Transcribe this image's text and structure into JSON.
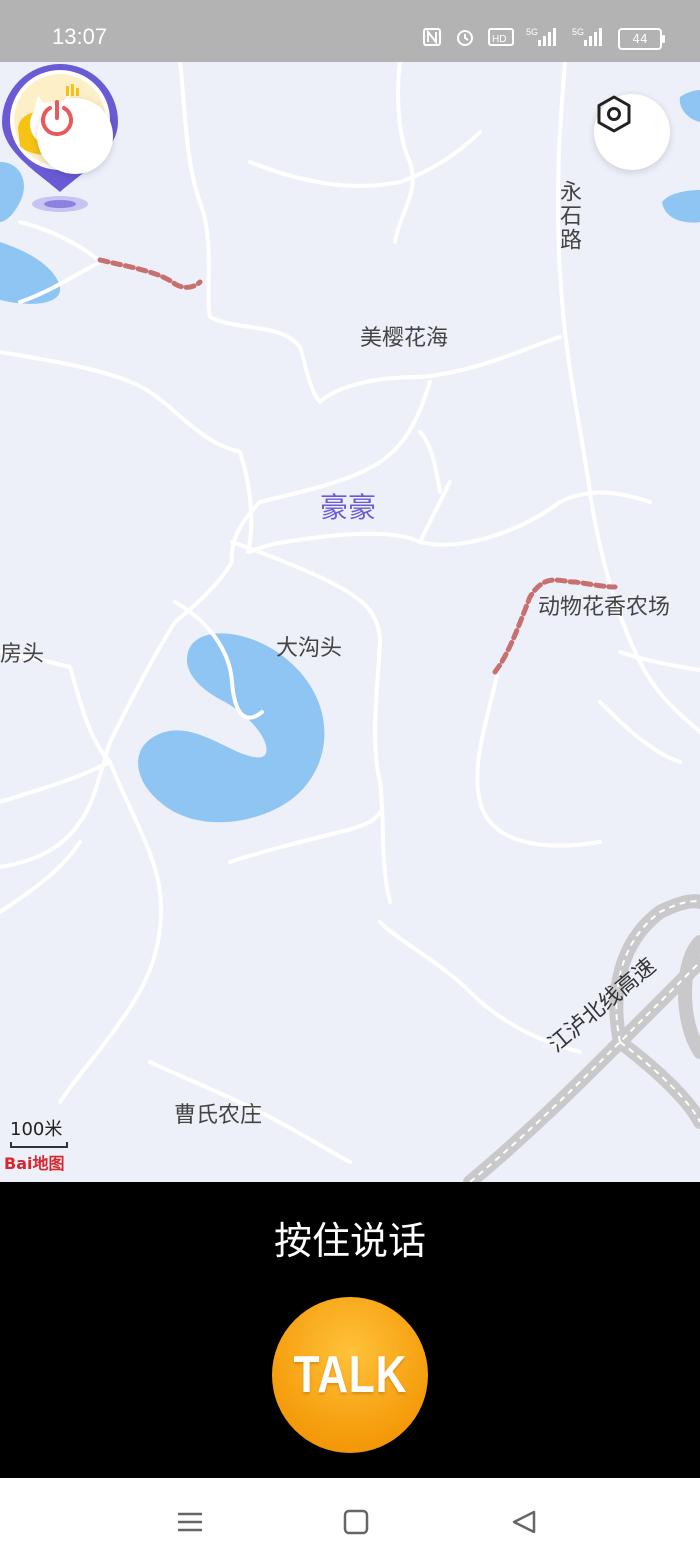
{
  "status_bar": {
    "time": "13:07",
    "icons": [
      "nfc-icon",
      "alarm-icon",
      "hd-icon",
      "5g-signal-icon",
      "5g-signal-icon",
      "battery-icon"
    ],
    "battery_level": "44"
  },
  "map": {
    "labels": {
      "yongshi_road": "永石路",
      "meiying_huahai": "美樱花海",
      "dongwu_huaxiang": "动物花香农场",
      "fangtou": "房头",
      "dagoutou": "大沟头",
      "caoshi": "曹氏农庄",
      "highway": "江泸北线高速"
    },
    "scale_label": "100米",
    "map_logo": "Bai地图",
    "user_pin_name": "豪豪"
  },
  "controls": {
    "power_icon": "power-icon",
    "settings_icon": "settings-icon"
  },
  "talk": {
    "hint": "按住说话",
    "button_label": "TALK"
  },
  "nav_bar": {
    "items": [
      "menu-icon",
      "home-icon",
      "back-icon"
    ]
  },
  "colors": {
    "map_bg": "#eef0f9",
    "water": "#8ec5f2",
    "accent_purple": "#6a5ad6",
    "talk_orange": "#f6a010",
    "power_red": "#e55a5a"
  }
}
